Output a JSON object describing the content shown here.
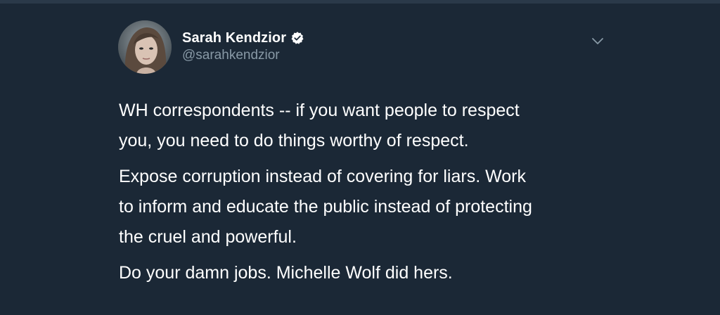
{
  "tweet": {
    "author": {
      "display_name": "Sarah Kendzior",
      "handle": "@sarahkendzior",
      "verified": true,
      "avatar_icon": "profile-photo"
    },
    "menu_icon": "chevron-down-icon",
    "paragraphs": [
      "WH correspondents -- if you want people to respect\nyou, you need to do things worthy of respect.",
      "Expose corruption instead of covering for liars. Work\nto inform and educate the public instead of protecting\nthe cruel and powerful.",
      "Do your damn jobs. Michelle Wolf did hers."
    ]
  },
  "colors": {
    "background": "#1b2836",
    "text": "#ffffff",
    "secondary_text": "#8899a6",
    "verified_badge": "#ffffff"
  }
}
